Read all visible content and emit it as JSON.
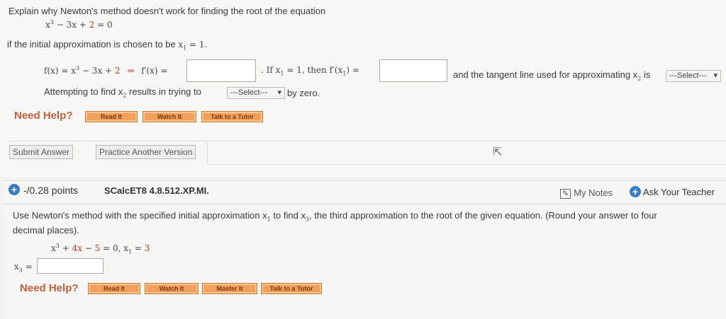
{
  "q1": {
    "prompt": "Explain why Newton's method doesn't work for finding the root of the equation",
    "equation": {
      "x": "x",
      "exp": "3",
      "rest": " − 3x + ",
      "const": "2",
      "eq": " = 0"
    },
    "initial": "if the initial approximation is chosen to be ",
    "initial_x": "x",
    "initial_sub": "1",
    "initial_val": " = 1.",
    "fx_label_pre": "f(x) = x",
    "fx_exp": "3",
    "fx_rest": " − 3x + ",
    "fx_const": "2",
    "arrow": "⇒",
    "fprime": "f′(x) =",
    "if_text": ". If  x",
    "if_sub": "1",
    "if_rest": " = 1,  then  f′(x",
    "if_sub2": "1",
    "if_end": ") =",
    "tangent_text": "and the tangent line used for approximating  x",
    "tangent_sub": "2",
    "tangent_is": "  is",
    "select_tangent": "---Select---",
    "attempt_text": "Attempting to find  x",
    "attempt_sub": "2",
    "attempt_rest": "  results in trying to",
    "select_attempt": "---Select---",
    "by_zero": "by zero.",
    "need_help": "Need Help?",
    "read_it": "Read It",
    "watch_it": "Watch It",
    "talk_tutor": "Talk to a Tutor",
    "submit": "Submit Answer",
    "practice": "Practice Another Version"
  },
  "q2": {
    "points": "-/0.28 points",
    "code": "SCalcET8 4.8.512.XP.MI.",
    "my_notes": "My Notes",
    "ask_teacher": "Ask Your Teacher",
    "prompt_a": "Use Newton's method with the specified initial approximation  x",
    "prompt_sub1": "1",
    "prompt_b": "  to find  x",
    "prompt_sub3": "3",
    "prompt_c": ", the third approximation to the root of the given equation. (Round your answer to four",
    "prompt_line2": "decimal places).",
    "eq_x": "x",
    "eq_exp": "3",
    "eq_plus": " + ",
    "eq_4x": "4x",
    "eq_minus": " − ",
    "eq_5": "5",
    "eq_rest": " = 0,     x",
    "eq_sub": "1",
    "eq_eq": " = ",
    "eq_3": "3",
    "x3_label": "x",
    "x3_sub": "3",
    "x3_eq": " =",
    "need_help": "Need Help?",
    "read_it": "Read It",
    "watch_it": "Watch It",
    "master_it": "Master It",
    "talk_tutor": "Talk to a Tutor"
  },
  "colors": {
    "accent_blue": "#3b7dc4",
    "help_orange": "#c0603a",
    "button_orange": "#f0a05a",
    "math_red": "#c0392b"
  }
}
